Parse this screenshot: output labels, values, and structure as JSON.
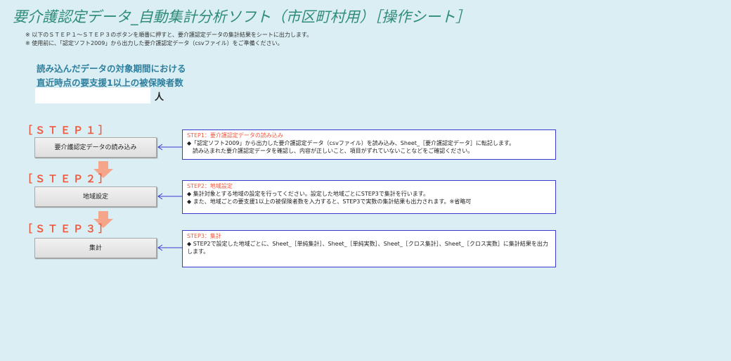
{
  "header": {
    "title": "要介護認定データ_自動集計分析ソフト（市区町村用）［操作シート］",
    "notes": [
      "※ 以下のＳＴＥＰ１～ＳＴＥＰ３のボタンを順番に押すと、要介護認定データの集計結果をシートに出力します。",
      "※ 使用前に、「認定ソフト2009」から出力した要介護認定データ（csvファイル）をご準備ください。"
    ]
  },
  "count_section": {
    "line1": "読み込んだデータの対象期間における",
    "line2": "直近時点の要支援1以上の被保険者数",
    "value": "",
    "unit": "人"
  },
  "steps": [
    {
      "label": "［ＳＴＥＰ１］",
      "button": "要介護認定データの読み込み",
      "desc_title": "STEP1：要介護認定データの読み込み",
      "desc_lines": [
        "◆「認定ソフト2009」から出力した要介護認定データ（csvファイル）を読み込み、Sheet_［要介護認定データ］に転記します。",
        "　読み込まれた要介護認定データを確認し、内容が正しいこと、項目がずれていないことなどをご確認ください。"
      ]
    },
    {
      "label": "［ＳＴＥＰ２］",
      "button": "地域設定",
      "desc_title": "STEP2：地域設定",
      "desc_lines": [
        "◆ 集計対象とする地域の設定を行ってください。設定した地域ごとにSTEP3で集計を行います。",
        "◆ また、地域ごとの要支援1以上の被保険者数を入力すると、STEP3で実数の集計結果も出力されます。※省略可"
      ]
    },
    {
      "label": "［ＳＴＥＰ３］",
      "button": "集計",
      "desc_title": "STEP3：集計",
      "desc_lines": [
        "◆ STEP2で設定した地域ごとに、Sheet_［単純集計］、Sheet_［単純実数］、Sheet_［クロス集計］、Sheet_［クロス実数］に集計結果を出力します。"
      ]
    }
  ],
  "colors": {
    "background": "#daeef3",
    "title": "#2f8b7a",
    "step_label": "#f0583e",
    "arrow": "#f4a58a",
    "border": "#3a3acf"
  }
}
